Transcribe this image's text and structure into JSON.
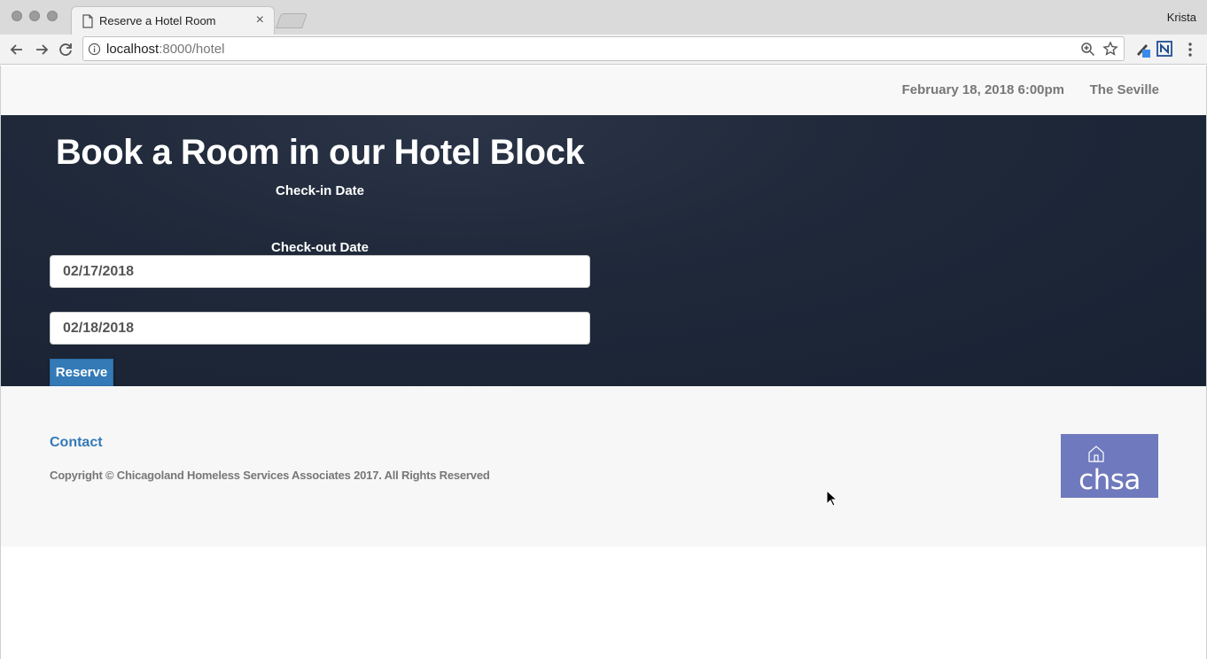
{
  "browser": {
    "tab_title": "Reserve a Hotel Room",
    "tab_close": "×",
    "profile_name": "Krista",
    "url_host": "localhost",
    "url_rest": ":8000/hotel",
    "icons": [
      "page-icon",
      "back-icon",
      "forward-icon",
      "reload-icon",
      "info-icon",
      "zoom-icon",
      "star-icon",
      "extension-pen-icon",
      "extension-n-icon",
      "menu-icon"
    ]
  },
  "header": {
    "date": "February 18, 2018 6:00pm",
    "venue": "The Seville"
  },
  "hero": {
    "title": "Book a Room in our Hotel Block",
    "checkin_label": "Check-in Date",
    "checkin_value": "02/17/2018",
    "checkout_label": "Check-out Date",
    "checkout_value": "02/18/2018",
    "reserve_label": "Reserve"
  },
  "footer": {
    "contact_label": "Contact",
    "copyright": "Copyright © Chicagoland Homeless Services Associates 2017. All Rights Reserved",
    "logo_text": "chsa"
  },
  "colors": {
    "hero_bg": "#1f293a",
    "button": "#337ab7",
    "link": "#337ab7",
    "logo_bg": "#6f79bd",
    "muted_text": "#777777"
  }
}
